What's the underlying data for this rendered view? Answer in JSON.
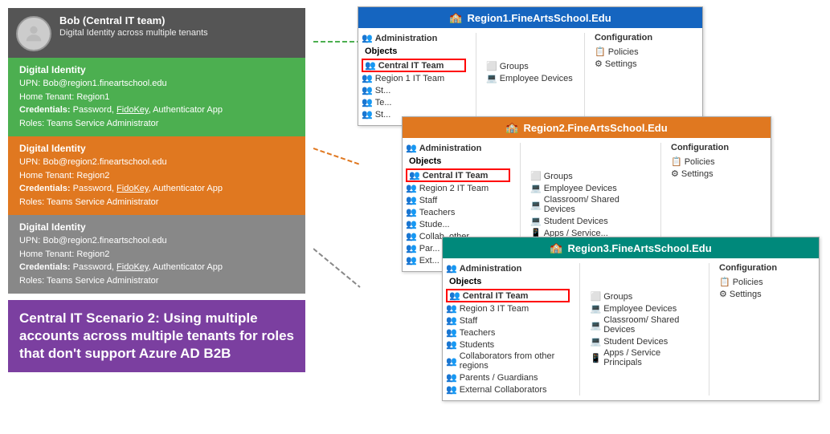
{
  "left": {
    "bob_label": "Bob (Central IT team)",
    "identities": [
      {
        "color": "green",
        "label": "Digital Identity",
        "upn": "UPN: Bob@region1.fineartschool.edu",
        "home_tenant": "Home Tenant: Region1",
        "credentials": "Credentials: Password, FidoKey, Authenticator App",
        "roles": "Roles: Teams Service Administrator"
      },
      {
        "color": "orange",
        "label": "Digital Identity",
        "upn": "UPN: Bob@region2.fineartschool.edu",
        "home_tenant": "Home Tenant: Region2",
        "credentials": "Credentials: Password, FidoKey, Authenticator App",
        "roles": "Roles: Teams Service Administrator"
      },
      {
        "color": "gray",
        "label": "Digital Identity",
        "upn": "UPN: Bob@region2.fineartschool.edu",
        "home_tenant": "Home Tenant: Region2",
        "credentials": "Credentials: Password, FidoKey, Authenticator App",
        "roles": "Roles: Teams Service Administrator"
      }
    ],
    "caption": "Central IT Scenario 2: Using multiple accounts across multiple tenants for roles that don't support Azure AD B2B"
  },
  "tenants": [
    {
      "id": "region1",
      "title": "Region1.FineArtsSchool.Edu",
      "header_color": "blue",
      "objects": [
        {
          "label": "Central IT Team",
          "highlighted": true
        },
        {
          "label": "Region 1 IT Team",
          "highlighted": false
        },
        {
          "label": "St...",
          "highlighted": false
        },
        {
          "label": "Te...",
          "highlighted": false
        },
        {
          "label": "St...",
          "highlighted": false
        }
      ],
      "mid_items": [
        {
          "label": "Groups"
        },
        {
          "label": "Employee Devices"
        }
      ],
      "config_items": [
        {
          "label": "Policies"
        },
        {
          "label": "Settings"
        }
      ]
    },
    {
      "id": "region2",
      "title": "Region2.FineArtsSchool.Edu",
      "header_color": "orange",
      "objects": [
        {
          "label": "Central IT Team",
          "highlighted": true
        },
        {
          "label": "Region 2 IT Team",
          "highlighted": false
        },
        {
          "label": "Staff",
          "highlighted": false
        },
        {
          "label": "Teachers",
          "highlighted": false
        },
        {
          "label": "Stude...",
          "highlighted": false
        },
        {
          "label": "Collab. other...",
          "highlighted": false
        },
        {
          "label": "Par...",
          "highlighted": false
        },
        {
          "label": "Ext...",
          "highlighted": false
        }
      ],
      "mid_items": [
        {
          "label": "Groups"
        },
        {
          "label": "Employee Devices"
        },
        {
          "label": "Classroom/ Shared Devices"
        },
        {
          "label": "Student Devices"
        },
        {
          "label": "Apps / Service..."
        }
      ],
      "config_items": [
        {
          "label": "Policies"
        },
        {
          "label": "Settings"
        }
      ]
    },
    {
      "id": "region3",
      "title": "Region3.FineArtsSchool.Edu",
      "header_color": "teal",
      "objects": [
        {
          "label": "Central IT Team",
          "highlighted": true
        },
        {
          "label": "Region 3 IT Team",
          "highlighted": false
        },
        {
          "label": "Staff",
          "highlighted": false
        },
        {
          "label": "Teachers",
          "highlighted": false
        },
        {
          "label": "Students",
          "highlighted": false
        },
        {
          "label": "Collaborators from other regions",
          "highlighted": false
        },
        {
          "label": "Parents / Guardians",
          "highlighted": false
        },
        {
          "label": "External Collaborators",
          "highlighted": false
        }
      ],
      "mid_items": [
        {
          "label": "Groups"
        },
        {
          "label": "Employee Devices"
        },
        {
          "label": "Classroom/ Shared Devices"
        },
        {
          "label": "Student Devices"
        },
        {
          "label": "Apps / Service Principals"
        }
      ],
      "config_items": [
        {
          "label": "Policies"
        },
        {
          "label": "Settings"
        }
      ]
    }
  ],
  "icons": {
    "building": "🏫",
    "people": "👥",
    "device": "💻",
    "gear": "⚙",
    "shield": "🛡",
    "policy": "📋",
    "user": "👤"
  }
}
